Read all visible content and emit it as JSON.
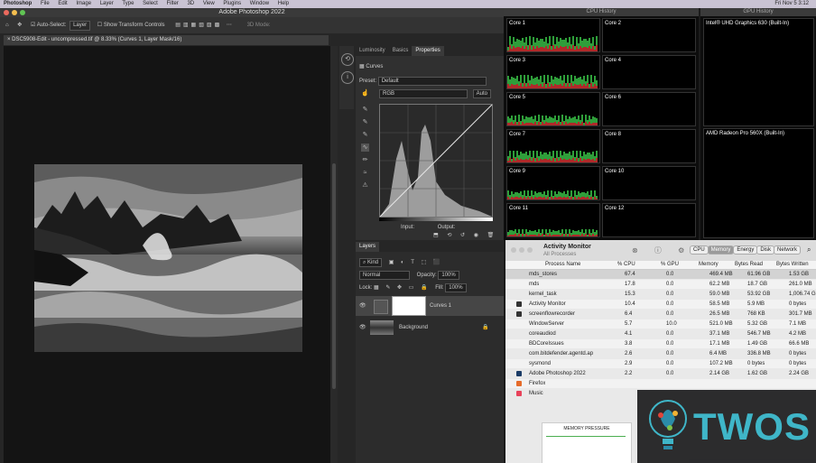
{
  "menubar": {
    "items": [
      "Photoshop",
      "File",
      "Edit",
      "Image",
      "Layer",
      "Type",
      "Select",
      "Filter",
      "3D",
      "View",
      "Plugins",
      "Window",
      "Help"
    ],
    "right": "Fri Nov 5 3:12"
  },
  "photoshop": {
    "window_title": "Adobe Photoshop 2022",
    "options": {
      "auto_select_label": "Auto-Select:",
      "auto_select_value": "Layer",
      "transform_label": "Show Transform Controls",
      "mode_label": "3D Mode:"
    },
    "doc_tab": "DSC5908-Edit - uncompressed.tif @ 8.33% (Curves 1, Layer Mask/16)",
    "panel_tabs": [
      "Luminosity",
      "Basics",
      "Properties"
    ],
    "properties": {
      "title": "Curves",
      "preset_label": "Preset:",
      "preset_value": "Default",
      "channel_value": "RGB",
      "auto_label": "Auto",
      "input_label": "Input:",
      "output_label": "Output:"
    },
    "layers": {
      "tab": "Layers",
      "kind_label": "Kind",
      "blend_mode": "Normal",
      "opacity_label": "Opacity:",
      "opacity_value": "100%",
      "lock_label": "Lock:",
      "fill_label": "Fill:",
      "fill_value": "100%",
      "items": [
        {
          "name": "Curves 1"
        },
        {
          "name": "Background"
        }
      ]
    }
  },
  "cpu_history": {
    "title": "CPU History",
    "cores": [
      "Core 1",
      "Core 2",
      "Core 3",
      "Core 4",
      "Core 5",
      "Core 6",
      "Core 7",
      "Core 8",
      "Core 9",
      "Core 10",
      "Core 11",
      "Core 12"
    ],
    "core_loads": [
      0.55,
      0.05,
      0.5,
      0.05,
      0.4,
      0.05,
      0.45,
      0.05,
      0.35,
      0.05,
      0.3,
      0.05
    ]
  },
  "gpu_history": {
    "title": "GPU History",
    "gpus": [
      "Intel® UHD Graphics 630 (Built-In)",
      "AMD Radeon Pro 560X (Built-In)"
    ]
  },
  "activity_monitor": {
    "title": "Activity Monitor",
    "subtitle": "All Processes",
    "tabs": [
      "CPU",
      "Memory",
      "Energy",
      "Disk",
      "Network"
    ],
    "active_tab": "Memory",
    "columns": [
      "Process Name",
      "% CPU",
      "% GPU",
      "Memory",
      "Bytes Read",
      "Bytes Written"
    ],
    "rows": [
      {
        "name": "mds_stores",
        "cpu": "67.4",
        "gpu": "0.0",
        "mem": "469.4 MB",
        "read": "61.96 GB",
        "written": "1.53 GB"
      },
      {
        "name": "mds",
        "cpu": "17.8",
        "gpu": "0.0",
        "mem": "62.2 MB",
        "read": "18.7 GB",
        "written": "261.0 MB"
      },
      {
        "name": "kernel_task",
        "cpu": "15.3",
        "gpu": "0.0",
        "mem": "59.0 MB",
        "read": "53.92 GB",
        "written": "1,006.74 GB"
      },
      {
        "name": "Activity Monitor",
        "cpu": "10.4",
        "gpu": "0.0",
        "mem": "58.5 MB",
        "read": "5.9 MB",
        "written": "0 bytes"
      },
      {
        "name": "screenflowrecorder",
        "cpu": "6.4",
        "gpu": "0.0",
        "mem": "26.5 MB",
        "read": "768 KB",
        "written": "301.7 MB"
      },
      {
        "name": "WindowServer",
        "cpu": "5.7",
        "gpu": "10.0",
        "mem": "521.0 MB",
        "read": "5.32 GB",
        "written": "7.1 MB"
      },
      {
        "name": "coreaudiod",
        "cpu": "4.1",
        "gpu": "0.0",
        "mem": "37.1 MB",
        "read": "546.7 MB",
        "written": "4.2 MB"
      },
      {
        "name": "BDCoreIssues",
        "cpu": "3.8",
        "gpu": "0.0",
        "mem": "17.1 MB",
        "read": "1.49 GB",
        "written": "66.6 MB"
      },
      {
        "name": "com.bitdefender.agentd.ap",
        "cpu": "2.6",
        "gpu": "0.0",
        "mem": "6.4 MB",
        "read": "336.8 MB",
        "written": "0 bytes"
      },
      {
        "name": "sysmond",
        "cpu": "2.9",
        "gpu": "0.0",
        "mem": "107.2 MB",
        "read": "0 bytes",
        "written": "0 bytes"
      },
      {
        "name": "Adobe Photoshop 2022",
        "cpu": "2.2",
        "gpu": "0.0",
        "mem": "2.14 GB",
        "read": "1.62 GB",
        "written": "2.24 GB"
      },
      {
        "name": "Firefox",
        "cpu": "",
        "gpu": "",
        "mem": "",
        "read": "",
        "written": ""
      },
      {
        "name": "Music",
        "cpu": "",
        "gpu": "",
        "mem": "",
        "read": "",
        "written": ""
      }
    ],
    "memory_pressure_label": "MEMORY PRESSURE"
  },
  "watermark": {
    "text": "TWOS"
  },
  "colors": {
    "cpu_user": "#2f9e3a",
    "cpu_system": "#b02a2a",
    "accent_blue": "#2f6fd6"
  }
}
